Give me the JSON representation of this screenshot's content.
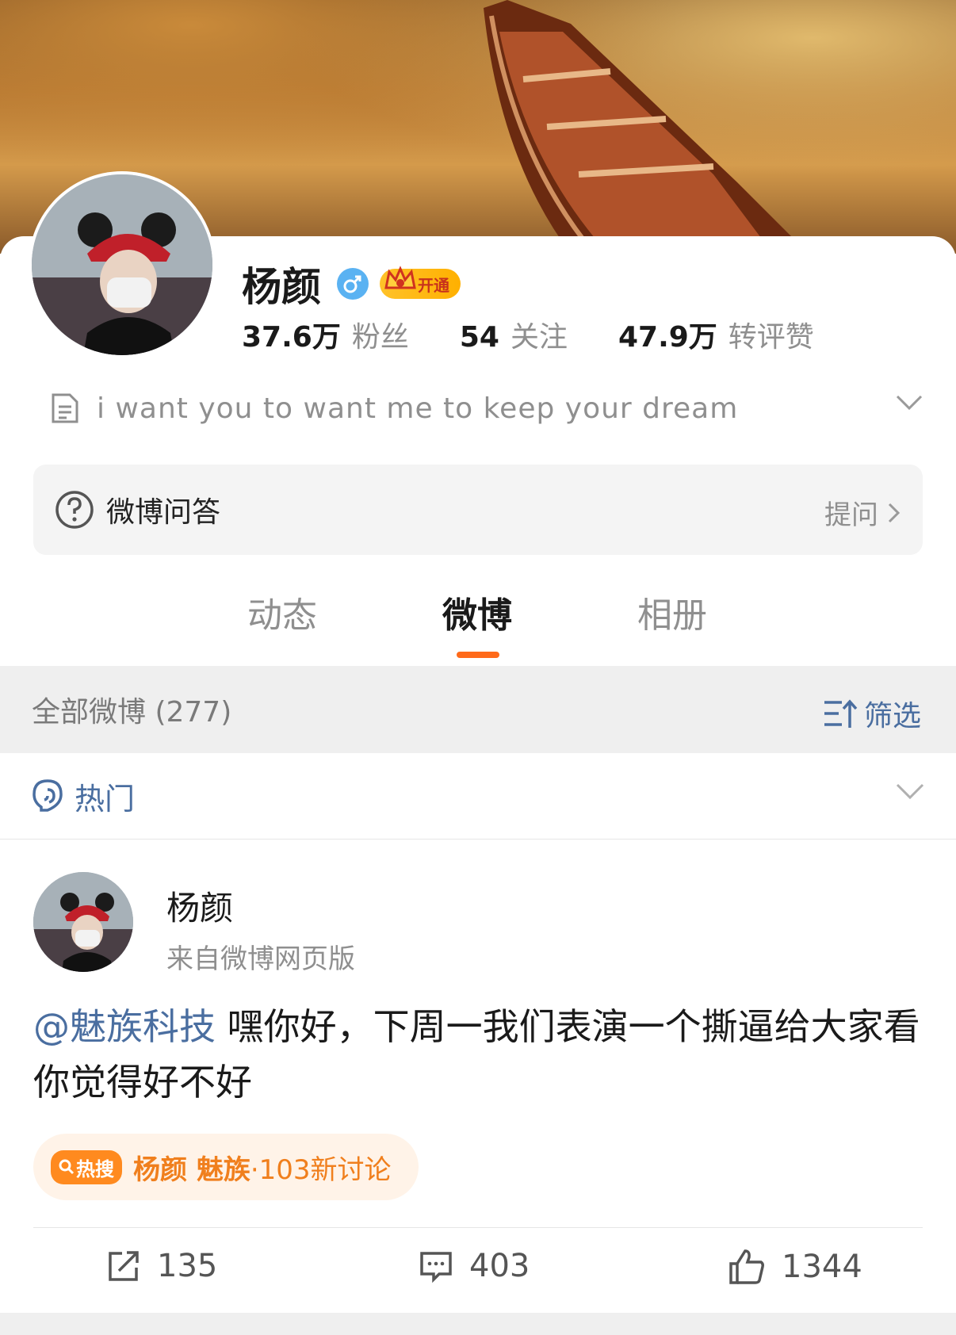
{
  "profile": {
    "name": "杨颜",
    "gender_icon": "male-icon",
    "vip_label": "开通",
    "stats": [
      {
        "num": "37.6万",
        "label": "粉丝"
      },
      {
        "num": "54",
        "label": "关注"
      },
      {
        "num": "47.9万",
        "label": "转评赞"
      }
    ],
    "bio": "i want you to want me to keep your dream"
  },
  "qa": {
    "title": "微博问答",
    "action": "提问"
  },
  "tabs": [
    {
      "label": "动态",
      "active": false
    },
    {
      "label": "微博",
      "active": true
    },
    {
      "label": "相册",
      "active": false
    }
  ],
  "filter": {
    "label": "全部微博 (277)",
    "action": "筛选"
  },
  "hot": {
    "label": "热门"
  },
  "post": {
    "author": "杨颜",
    "source": "来自微博网页版",
    "mention": "@魅族科技",
    "text": " 嘿你好，下周一我们表演一个撕逼给大家看你觉得好不好",
    "hot_tag": "热搜",
    "hot_topic": "杨颜 魅族",
    "hot_meta": "·103新讨论",
    "reposts": "135",
    "comments": "403",
    "likes": "1344"
  },
  "colors": {
    "accent": "#ff6a1a",
    "link": "#4a6ea0",
    "hot": "#ff8a1f"
  }
}
